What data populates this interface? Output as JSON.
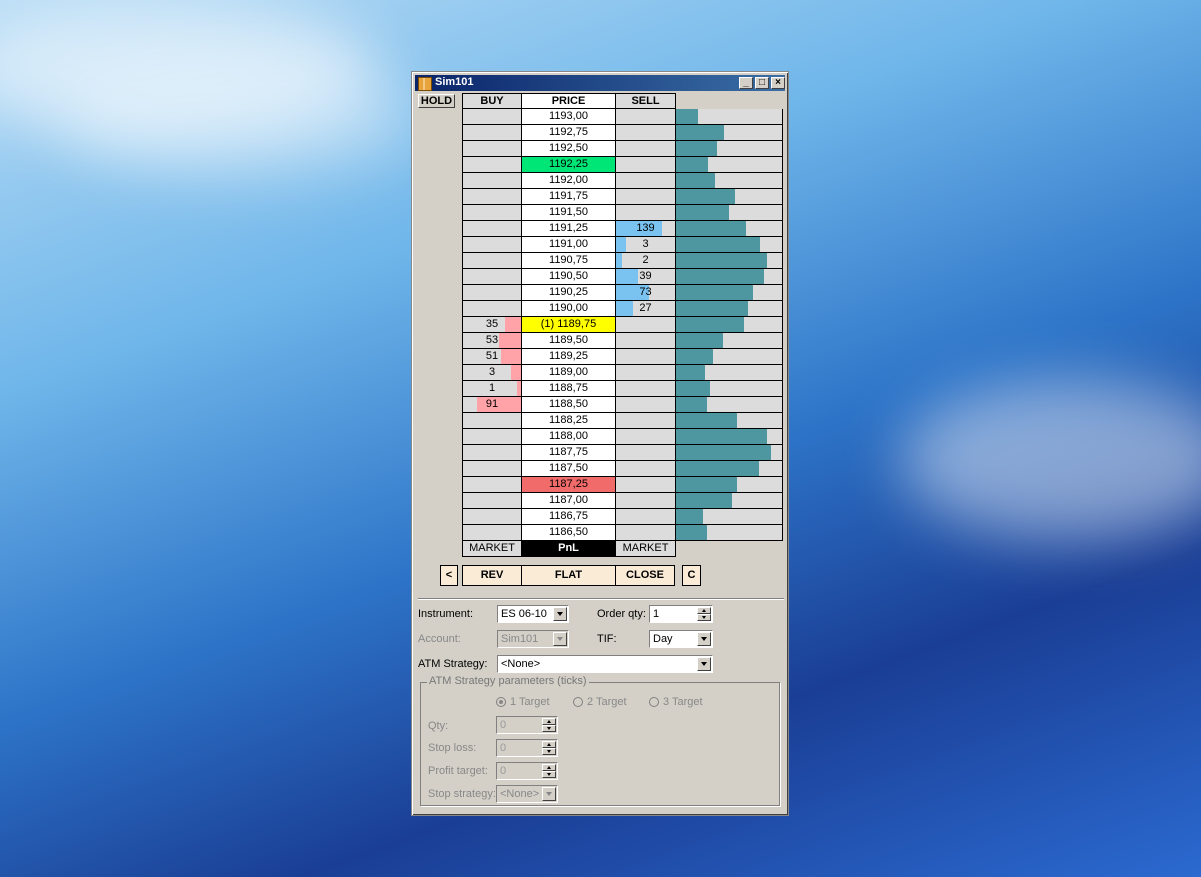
{
  "window": {
    "title": "Sim101"
  },
  "hold_label": "HOLD",
  "headers": {
    "buy": "BUY",
    "price": "PRICE",
    "sell": "SELL"
  },
  "colors": {
    "last_price": "#00e676",
    "position": "#ffff00",
    "low_mark": "#f26b6b",
    "bid_bar": "#ffa3a8",
    "ask_bar": "#7ac3f0",
    "volume_bar": "#4f97a0"
  },
  "ladder": [
    {
      "price": "1193,00",
      "buy": "",
      "sell": "",
      "vol": 0.21,
      "hl": ""
    },
    {
      "price": "1192,75",
      "buy": "",
      "sell": "",
      "vol": 0.45,
      "hl": ""
    },
    {
      "price": "1192,50",
      "buy": "",
      "sell": "",
      "vol": 0.39,
      "hl": ""
    },
    {
      "price": "1192,25",
      "buy": "",
      "sell": "",
      "vol": 0.3,
      "hl": "last"
    },
    {
      "price": "1192,00",
      "buy": "",
      "sell": "",
      "vol": 0.37,
      "hl": ""
    },
    {
      "price": "1191,75",
      "buy": "",
      "sell": "",
      "vol": 0.56,
      "hl": ""
    },
    {
      "price": "1191,50",
      "buy": "",
      "sell": "",
      "vol": 0.5,
      "hl": ""
    },
    {
      "price": "1191,25",
      "buy": "",
      "sell": "139",
      "sellFrac": 0.76,
      "vol": 0.66,
      "hl": ""
    },
    {
      "price": "1191,00",
      "buy": "",
      "sell": "3",
      "sellFrac": 0.16,
      "vol": 0.79,
      "hl": ""
    },
    {
      "price": "1190,75",
      "buy": "",
      "sell": "2",
      "sellFrac": 0.1,
      "vol": 0.86,
      "hl": ""
    },
    {
      "price": "1190,50",
      "buy": "",
      "sell": "39",
      "sellFrac": 0.36,
      "vol": 0.83,
      "hl": ""
    },
    {
      "price": "1190,25",
      "buy": "",
      "sell": "73",
      "sellFrac": 0.55,
      "vol": 0.73,
      "hl": ""
    },
    {
      "price": "1190,00",
      "buy": "",
      "sell": "27",
      "sellFrac": 0.28,
      "vol": 0.68,
      "hl": ""
    },
    {
      "price": "(1) 1189,75",
      "buy": "35",
      "buyFrac": 0.27,
      "sell": "",
      "vol": 0.64,
      "hl": "position"
    },
    {
      "price": "1189,50",
      "buy": "53",
      "buyFrac": 0.36,
      "sell": "",
      "vol": 0.44,
      "hl": ""
    },
    {
      "price": "1189,25",
      "buy": "51",
      "buyFrac": 0.34,
      "sell": "",
      "vol": 0.35,
      "hl": ""
    },
    {
      "price": "1189,00",
      "buy": "3",
      "buyFrac": 0.16,
      "sell": "",
      "vol": 0.27,
      "hl": ""
    },
    {
      "price": "1188,75",
      "buy": "1",
      "buyFrac": 0.06,
      "sell": "",
      "vol": 0.32,
      "hl": ""
    },
    {
      "price": "1188,50",
      "buy": "91",
      "buyFrac": 0.74,
      "sell": "",
      "vol": 0.29,
      "hl": ""
    },
    {
      "price": "1188,25",
      "buy": "",
      "sell": "",
      "vol": 0.58,
      "hl": ""
    },
    {
      "price": "1188,00",
      "buy": "",
      "sell": "",
      "vol": 0.86,
      "hl": ""
    },
    {
      "price": "1187,75",
      "buy": "",
      "sell": "",
      "vol": 0.9,
      "hl": ""
    },
    {
      "price": "1187,50",
      "buy": "",
      "sell": "",
      "vol": 0.78,
      "hl": ""
    },
    {
      "price": "1187,25",
      "buy": "",
      "sell": "",
      "vol": 0.58,
      "hl": "low"
    },
    {
      "price": "1187,00",
      "buy": "",
      "sell": "",
      "vol": 0.53,
      "hl": ""
    },
    {
      "price": "1186,75",
      "buy": "",
      "sell": "",
      "vol": 0.25,
      "hl": ""
    },
    {
      "price": "1186,50",
      "buy": "",
      "sell": "",
      "vol": 0.29,
      "hl": ""
    }
  ],
  "footer": {
    "buy_market": "MARKET",
    "pnl": "PnL",
    "sell_market": "MARKET"
  },
  "actions": {
    "left": "<",
    "rev": "REV",
    "flat": "FLAT",
    "close": "CLOSE",
    "right": "C"
  },
  "form": {
    "instrument_label": "Instrument:",
    "instrument_value": "ES 06-10",
    "order_qty_label": "Order qty:",
    "order_qty_value": "1",
    "account_label": "Account:",
    "account_value": "Sim101",
    "tif_label": "TIF:",
    "tif_value": "Day",
    "atm_label": "ATM Strategy:",
    "atm_value": "<None>"
  },
  "atm_params": {
    "legend": "ATM Strategy parameters (ticks)",
    "targets": [
      "1 Target",
      "2 Target",
      "3 Target"
    ],
    "qty_label": "Qty:",
    "qty_value": "0",
    "stop_loss_label": "Stop loss:",
    "stop_loss_value": "0",
    "profit_target_label": "Profit target:",
    "profit_target_value": "0",
    "stop_strategy_label": "Stop strategy:",
    "stop_strategy_value": "<None>"
  }
}
